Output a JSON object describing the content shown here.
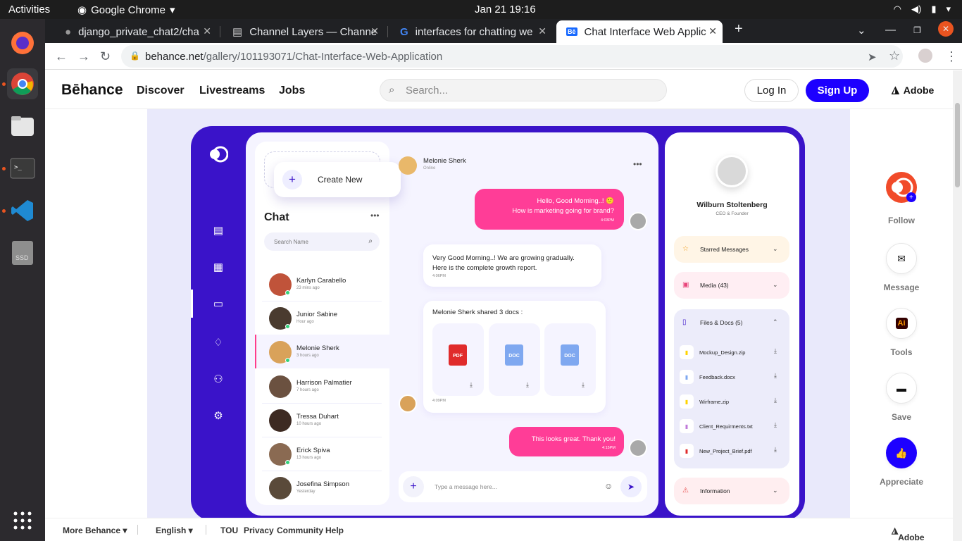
{
  "os": {
    "activities": "Activities",
    "app_name": "Google Chrome",
    "clock": "Jan 21  19:16"
  },
  "tabs": [
    {
      "label": "django_private_chat2/cha"
    },
    {
      "label": "Channel Layers — Channe"
    },
    {
      "label": "interfaces for chatting we"
    },
    {
      "label": "Chat Interface Web Applic"
    }
  ],
  "address": {
    "host": "behance.net",
    "path": "/gallery/101193071/Chat-Interface-Web-Application"
  },
  "behance": {
    "logo": "Bēhance",
    "nav": [
      "Discover",
      "Livestreams",
      "Jobs"
    ],
    "search_placeholder": "Search...",
    "login": "Log In",
    "signup": "Sign Up",
    "adobe": "Adobe"
  },
  "chat_app": {
    "create_new": "Create New",
    "chat_title": "Chat",
    "search_name": "Search Name",
    "contacts": [
      {
        "name": "Karlyn Carabello",
        "time": "23 mins ago",
        "online": true,
        "color": "#c0533a"
      },
      {
        "name": "Junior Sabine",
        "time": "Hour ago",
        "online": true,
        "color": "#4a3b2f"
      },
      {
        "name": "Melonie Sherk",
        "time": "3 hours ago",
        "online": true,
        "color": "#d9a25a"
      },
      {
        "name": "Harrison Palmatier",
        "time": "7 hours ago",
        "online": false,
        "color": "#6b5140"
      },
      {
        "name": "Tressa Duhart",
        "time": "10 hours ago",
        "online": false,
        "color": "#3d2a22"
      },
      {
        "name": "Erick Spiva",
        "time": "13 hours ago",
        "online": true,
        "color": "#8a6a52"
      },
      {
        "name": "Josefina Simpson",
        "time": "Yesterday",
        "online": false,
        "color": "#5a4a3a"
      }
    ],
    "conversation": {
      "contact_name": "Melonie Sherk",
      "status": "Online",
      "msg1_line1": "Hello, Good Morning..! 🙂",
      "msg1_line2": "How is marketing going for brand?",
      "msg1_time": "4:03PM",
      "msg2_line1": "Very Good Morning..! We are growing gradually.",
      "msg2_line2": "Here is the complete growth report.",
      "msg2_time": "4:06PM",
      "shared_title": "Melonie Sherk shared 3 docs :",
      "docs": [
        "PDF",
        "DOC",
        "DOC"
      ],
      "shared_time": "4:09PM",
      "msg4": "This looks great. Thank you!",
      "msg4_time": "4:15PM",
      "input_placeholder": "Type a message here..."
    },
    "profile": {
      "name": "Wilburn Stoltenberg",
      "role": "CEO & Founder",
      "starred": "Starred Messages",
      "media": "Media (43)",
      "files": "Files & Docs (5)",
      "file_list": [
        "Mockup_Design.zip",
        "Feedback.docx",
        "Wirframe.zip",
        "Client_Requirments.txt",
        "New_Project_Brief.pdf"
      ],
      "information": "Information"
    }
  },
  "rail": {
    "follow": "Follow",
    "message": "Message",
    "tools": "Tools",
    "save": "Save",
    "appreciate": "Appreciate"
  },
  "footer": {
    "more": "More Behance ▾",
    "lang": "English ▾",
    "tou": "TOU",
    "privacy": "Privacy",
    "community": "Community",
    "help": "Help",
    "adobe": "Adobe"
  },
  "colors": {
    "accent": "#1d00ff",
    "frame": "#3a13c9",
    "pink": "#ff3d97"
  }
}
